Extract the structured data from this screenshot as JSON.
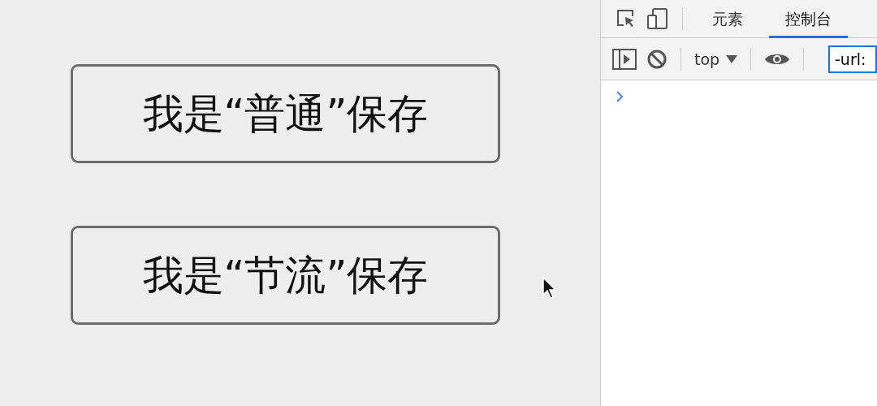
{
  "buttons": [
    {
      "label": "我是“普通”保存"
    },
    {
      "label": "我是“节流”保存"
    }
  ],
  "devtools": {
    "tabs": [
      {
        "label": "元素",
        "selected": false
      },
      {
        "label": "控制台",
        "selected": true
      }
    ],
    "context": "top",
    "filter": {
      "value": "-url:"
    }
  }
}
